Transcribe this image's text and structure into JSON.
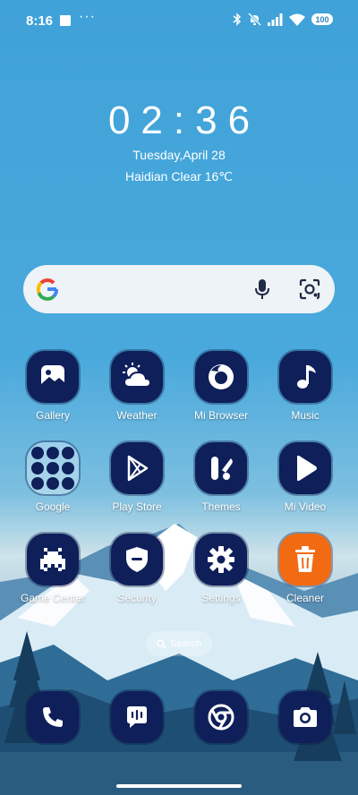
{
  "status_bar": {
    "time": "8:16",
    "dots": "···",
    "battery": "100",
    "icons": [
      "bluetooth-icon",
      "mute-icon",
      "signal-icon",
      "wifi-icon",
      "battery-icon"
    ]
  },
  "clock": {
    "time": "02:36",
    "date": "Tuesday,April 28",
    "weather": "Haidian Clear 16℃"
  },
  "search_bar": {
    "icons": [
      "google-icon",
      "mic-icon",
      "lens-icon"
    ]
  },
  "apps": [
    {
      "label": "Gallery",
      "icon": "gallery-icon"
    },
    {
      "label": "Weather",
      "icon": "weather-icon"
    },
    {
      "label": "Mi Browser",
      "icon": "browser-icon"
    },
    {
      "label": "Music",
      "icon": "music-icon"
    },
    {
      "label": "Google",
      "icon": "folder-icon"
    },
    {
      "label": "Play Store",
      "icon": "play-store-icon"
    },
    {
      "label": "Themes",
      "icon": "themes-icon"
    },
    {
      "label": "Mi Video",
      "icon": "video-icon"
    },
    {
      "label": "Game Center",
      "icon": "game-icon"
    },
    {
      "label": "Security",
      "icon": "security-icon"
    },
    {
      "label": "Settings",
      "icon": "settings-icon"
    },
    {
      "label": "Cleaner",
      "icon": "cleaner-icon"
    }
  ],
  "home_search": {
    "label": "Search"
  },
  "dock": [
    {
      "icon": "phone-icon"
    },
    {
      "icon": "messages-icon"
    },
    {
      "icon": "chrome-icon"
    },
    {
      "icon": "camera-icon"
    }
  ],
  "colors": {
    "icon_bg": "#0e1f5a",
    "cleaner_bg": "#f26a12",
    "sky": "#3fa2d8"
  }
}
